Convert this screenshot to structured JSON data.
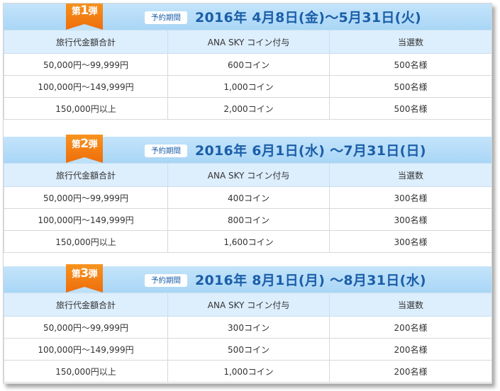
{
  "columns": [
    "旅行代金額合計",
    "ANA SKY コイン付与",
    "当選数"
  ],
  "badge_label": "予約期間",
  "sections": [
    {
      "ribbon_prefix": "第",
      "ribbon_num": "1",
      "ribbon_suffix": "弾",
      "period": "2016年 4月8日(金)〜5月31日(火)",
      "rows": [
        [
          "50,000円〜99,999円",
          "600コイン",
          "500名様"
        ],
        [
          "100,000円〜149,999円",
          "1,000コイン",
          "500名様"
        ],
        [
          "150,000円以上",
          "2,000コイン",
          "500名様"
        ]
      ]
    },
    {
      "ribbon_prefix": "第",
      "ribbon_num": "2",
      "ribbon_suffix": "弾",
      "period": "2016年 6月1日(水) 〜7月31日(日)",
      "rows": [
        [
          "50,000円〜99,999円",
          "400コイン",
          "300名様"
        ],
        [
          "100,000円〜149,999円",
          "800コイン",
          "300名様"
        ],
        [
          "150,000円以上",
          "1,600コイン",
          "300名様"
        ]
      ]
    },
    {
      "ribbon_prefix": "第",
      "ribbon_num": "3",
      "ribbon_suffix": "弾",
      "period": "2016年 8月1日(月) 〜8月31日(水)",
      "rows": [
        [
          "50,000円〜99,999円",
          "300コイン",
          "200名様"
        ],
        [
          "100,000円〜149,999円",
          "500コイン",
          "200名様"
        ],
        [
          "150,000円以上",
          "1,000コイン",
          "200名様"
        ]
      ]
    }
  ]
}
